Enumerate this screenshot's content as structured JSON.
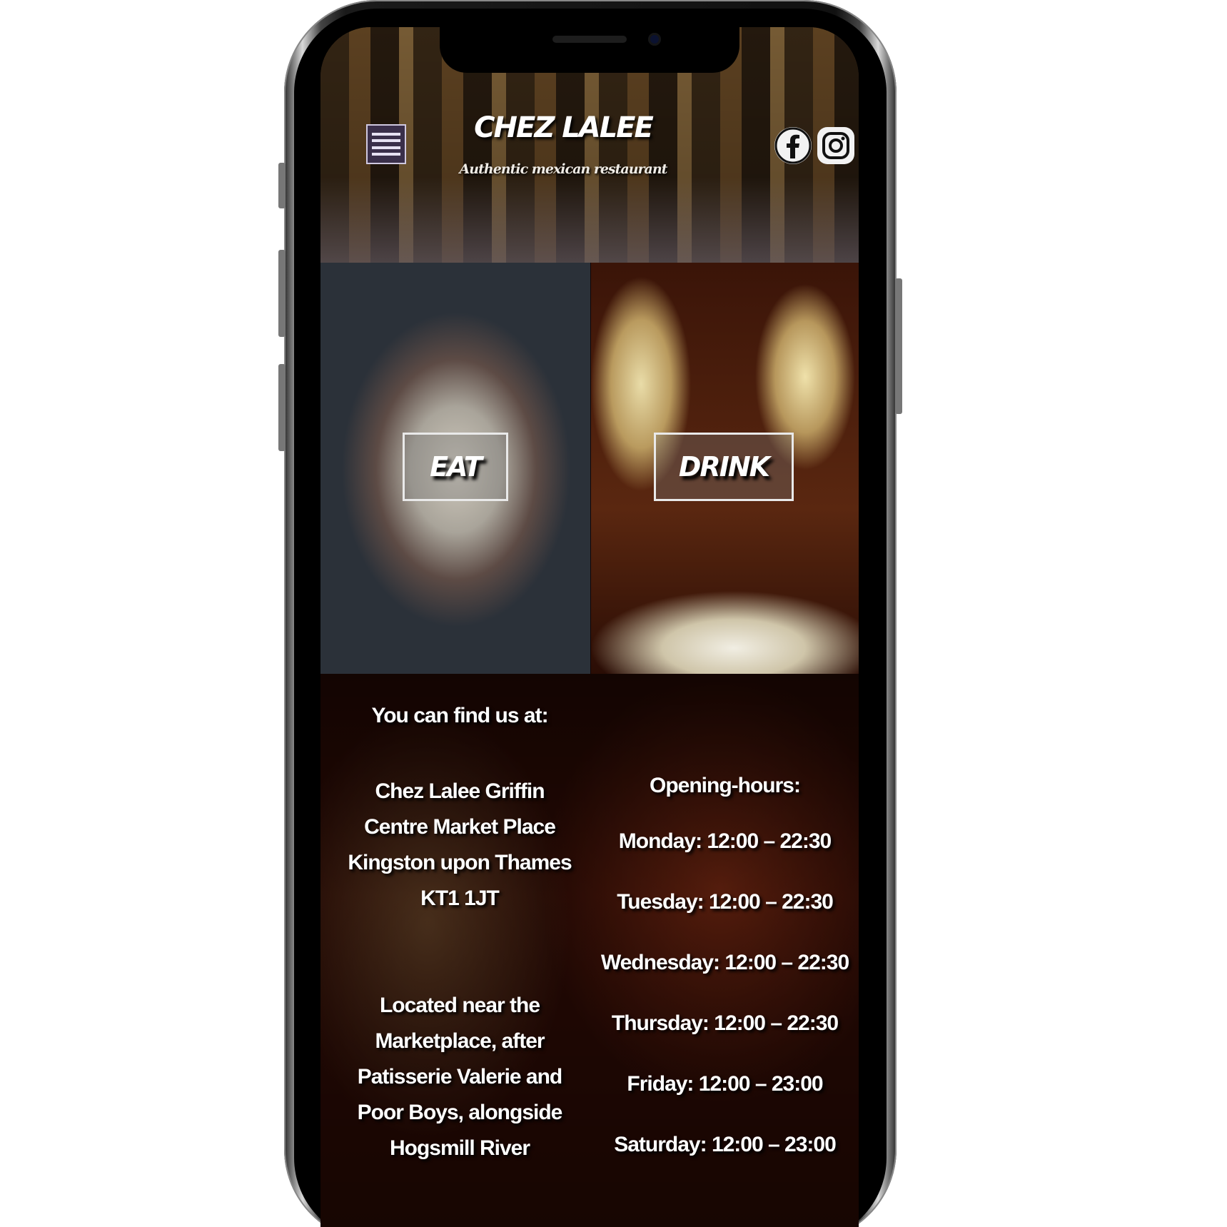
{
  "header": {
    "brand": "CHEZ LALEE",
    "tagline": "Authentic mexican restaurant",
    "menu_icon": "hamburger-menu-icon",
    "social": [
      {
        "name": "facebook",
        "icon": "facebook-icon"
      },
      {
        "name": "instagram",
        "icon": "instagram-icon"
      }
    ]
  },
  "tiles": {
    "eat": {
      "label": "EAT"
    },
    "drink": {
      "label": "DRINK"
    }
  },
  "info": {
    "find_title": "You can find us at:",
    "address": "Chez Lalee Griffin Centre Market Place Kingston upon Thames KT1 1JT",
    "located": "Located near the Marketplace, after Patisserie Valerie and Poor Boys, alongside Hogsmill River",
    "hours_title": "Opening-hours:",
    "hours": [
      "Monday: 12:00 – 22:30",
      "Tuesday: 12:00 – 22:30",
      "Wednesday: 12:00 – 22:30",
      "Thursday: 12:00 – 22:30",
      "Friday: 12:00 – 23:00",
      "Saturday: 12:00 – 23:00"
    ]
  },
  "colors": {
    "menu_button_bg": "#3a2f4a",
    "text": "#ffffff",
    "info_bg": "#2a0a04"
  }
}
